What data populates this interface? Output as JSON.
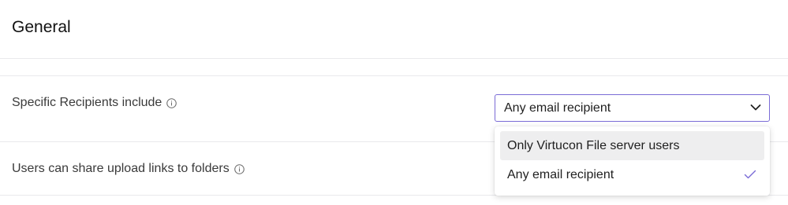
{
  "section": {
    "title": "General"
  },
  "settings": {
    "recipients": {
      "label": "Specific Recipients include",
      "info_icon": "info-icon",
      "selected_value": "Any email recipient"
    },
    "upload_links": {
      "label": "Users can share upload links to folders",
      "info_icon": "info-icon"
    }
  },
  "dropdown": {
    "options": [
      {
        "label": "Only Virtucon File server users",
        "selected": false,
        "hovered": true
      },
      {
        "label": "Any email recipient",
        "selected": true,
        "hovered": false
      }
    ],
    "chevron_icon": "chevron-down-icon",
    "check_icon": "check-icon"
  },
  "colors": {
    "accent": "#7a6bd6",
    "divider": "#e9e9ec",
    "hover_background": "#eeeeef"
  }
}
